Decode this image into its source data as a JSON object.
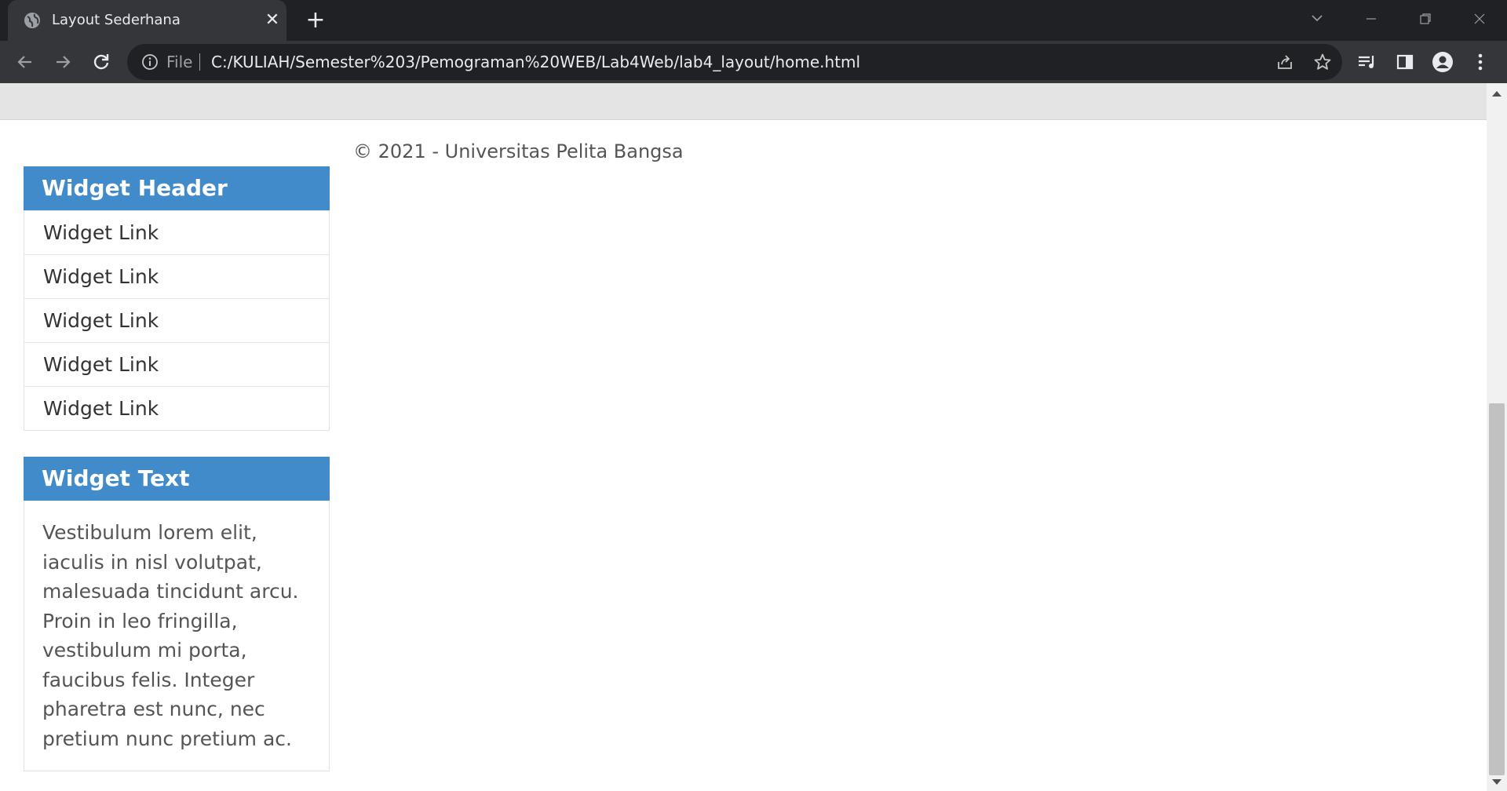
{
  "browser": {
    "tab": {
      "title": "Layout Sederhana",
      "favicon": "globe-icon"
    },
    "address": {
      "scheme_label": "File",
      "url": "C:/KULIAH/Semester%203/Pemograman%20WEB/Lab4Web/lab4_layout/home.html"
    }
  },
  "page": {
    "footer_text": "© 2021 - Universitas Pelita Bangsa",
    "widgets": {
      "links": {
        "header": "Widget Header",
        "items": [
          "Widget Link",
          "Widget Link",
          "Widget Link",
          "Widget Link",
          "Widget Link"
        ]
      },
      "text": {
        "header": "Widget Text",
        "body": "Vestibulum lorem elit, iaculis in nisl volutpat, malesuada tincidunt arcu. Proin in leo fringilla, vestibulum mi porta, faucibus felis. Integer pharetra est nunc, nec pretium nunc pretium ac."
      }
    }
  },
  "colors": {
    "widget_header": "#428bca",
    "nav_strip": "#e4e4e4",
    "titlebar": "#202124",
    "toolbar": "#35363a"
  }
}
